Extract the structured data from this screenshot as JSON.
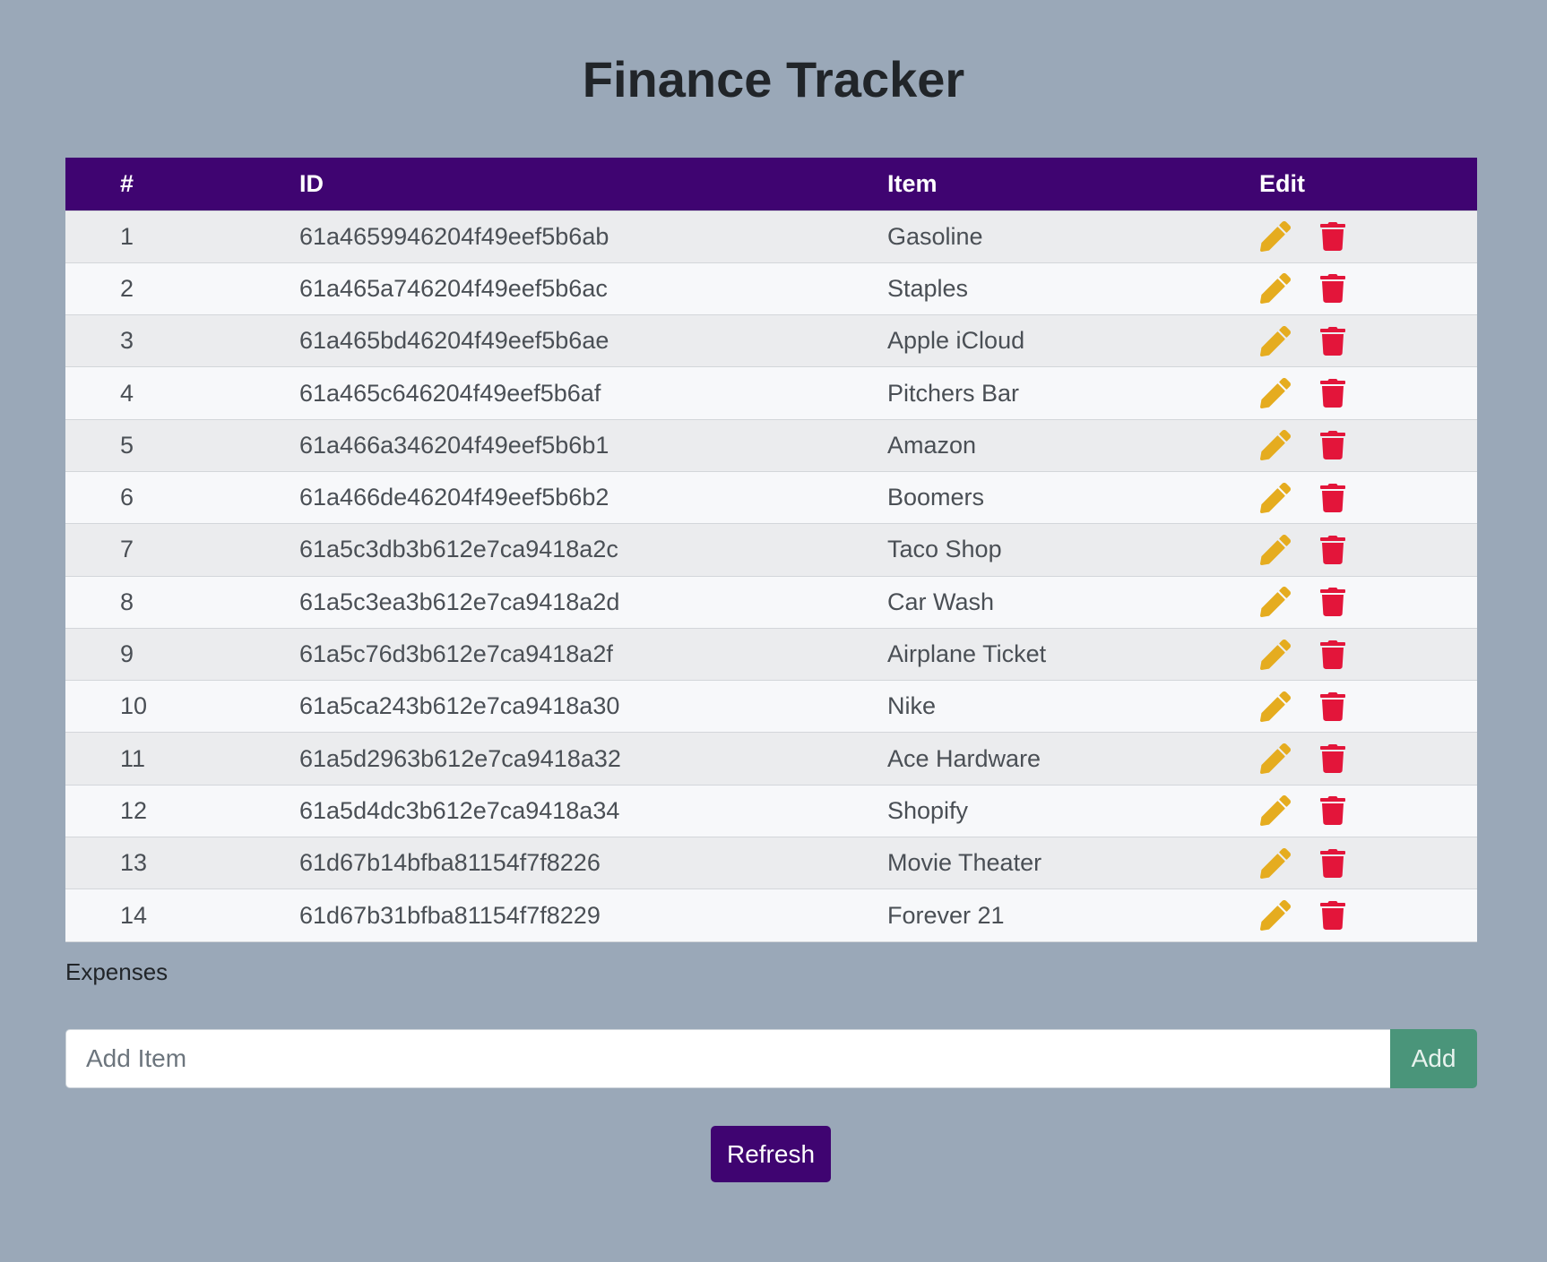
{
  "header": {
    "title": "Finance Tracker"
  },
  "table": {
    "columns": [
      "#",
      "ID",
      "Item",
      "Edit"
    ],
    "rows": [
      {
        "num": "1",
        "id": "61a4659946204f49eef5b6ab",
        "item": "Gasoline"
      },
      {
        "num": "2",
        "id": "61a465a746204f49eef5b6ac",
        "item": "Staples"
      },
      {
        "num": "3",
        "id": "61a465bd46204f49eef5b6ae",
        "item": "Apple iCloud"
      },
      {
        "num": "4",
        "id": "61a465c646204f49eef5b6af",
        "item": "Pitchers Bar"
      },
      {
        "num": "5",
        "id": "61a466a346204f49eef5b6b1",
        "item": "Amazon"
      },
      {
        "num": "6",
        "id": "61a466de46204f49eef5b6b2",
        "item": "Boomers"
      },
      {
        "num": "7",
        "id": "61a5c3db3b612e7ca9418a2c",
        "item": "Taco Shop"
      },
      {
        "num": "8",
        "id": "61a5c3ea3b612e7ca9418a2d",
        "item": "Car Wash"
      },
      {
        "num": "9",
        "id": "61a5c76d3b612e7ca9418a2f",
        "item": "Airplane Ticket"
      },
      {
        "num": "10",
        "id": "61a5ca243b612e7ca9418a30",
        "item": "Nike"
      },
      {
        "num": "11",
        "id": "61a5d2963b612e7ca9418a32",
        "item": "Ace Hardware"
      },
      {
        "num": "12",
        "id": "61a5d4dc3b612e7ca9418a34",
        "item": "Shopify"
      },
      {
        "num": "13",
        "id": "61d67b14bfba81154f7f8226",
        "item": "Movie Theater"
      },
      {
        "num": "14",
        "id": "61d67b31bfba81154f7f8229",
        "item": "Forever 21"
      }
    ],
    "caption": "Expenses",
    "row_icons": {
      "edit": "pencil-icon",
      "delete": "trash-icon"
    }
  },
  "add_form": {
    "placeholder": "Add Item",
    "value": "",
    "button_label": "Add"
  },
  "refresh": {
    "label": "Refresh"
  },
  "colors": {
    "background": "#9aa8b8",
    "header_bg": "#3f0471",
    "edit_icon": "#e5ac1f",
    "delete_icon": "#e3153a",
    "add_button": "#4a957a",
    "refresh_button": "#3f0471"
  }
}
